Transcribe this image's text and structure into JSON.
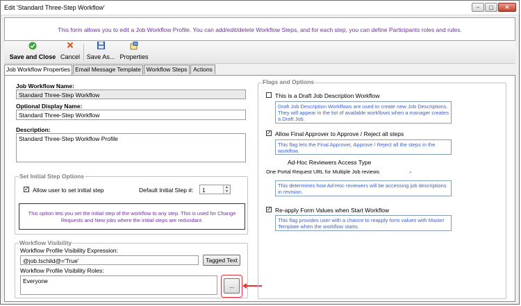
{
  "window": {
    "title": "Edit 'Standard Three-Step Workflow'",
    "controls": [
      "–",
      "▢",
      "✕"
    ]
  },
  "banner": {
    "text": "This form allows you to edit a Job Workflow Profile. You can add/edit/delete Workflow Steps, and for each step, you can define Participants roles and rules."
  },
  "toolbar": {
    "save_close": "Save and Close",
    "cancel": "Cancel",
    "save_as": "Save As...",
    "properties": "Properties"
  },
  "tabs": [
    "Job Workflow Properties",
    "Email Message Template",
    "Workflow Steps",
    "Actions"
  ],
  "left": {
    "name_label": "Job Workflow Name:",
    "name_value": "Standard Three-Step Workflow",
    "display_label": "Optional Display Name:",
    "display_value": "Standard Three-Step Workflow",
    "desc_label": "Description:",
    "desc_value": "Standard Three-Step Workflow Profile",
    "initial_group_title": "Set Initial Step Options",
    "allow_initial_label": "Allow user to set initial step",
    "default_step_label": "Default Initial Step #:",
    "default_step_value": "1",
    "initial_note": "This option lets you set the initial step of the workflow to any step.  This is used for Change Requests and New jobs where the initial steps are redundant.",
    "visibility_group_title": "Workflow Visibility",
    "expr_label": "Workflow Profile Visibility Expression:",
    "expr_value": "@job.Ischild@='True'",
    "tagged_text": "Tagged Text",
    "roles_label": "Workflow Profile Visibility Roles:",
    "roles_value": "Everyone",
    "ellipsis": "..."
  },
  "right": {
    "group_title": "Flags and Options",
    "draft_label": "This is a Draft Job Description Workflow",
    "draft_checked": false,
    "draft_note": "Draft Job Description Workflows are used to create new Job Descriptions. They will appear in the list of available workflows when a manager creates a Draft Job.",
    "final_label": "Allow Final Approver to Approve / Reject all steps",
    "final_checked": true,
    "final_note": "This flag lets the Final Approver, Approve / Reject all the steps in the workflow.",
    "adhoc_label": "Ad-Hoc Reviewers Access Type",
    "adhoc_value": "One Portal Request URL for Multiple Job reviews",
    "adhoc_note": "This determines how Ad-Hoc reviewers will be accessing job descriptions in revision.",
    "reapply_label": "Re-apply Form Values when Start Workflow",
    "reapply_checked": true,
    "reapply_note": "This flag provides user with a chance to reapply form values with Master Template when the workflow starts."
  },
  "colors": {
    "banner_text": "#7030a0",
    "note_text": "#3f5fd1",
    "highlight": "#e0343a"
  }
}
